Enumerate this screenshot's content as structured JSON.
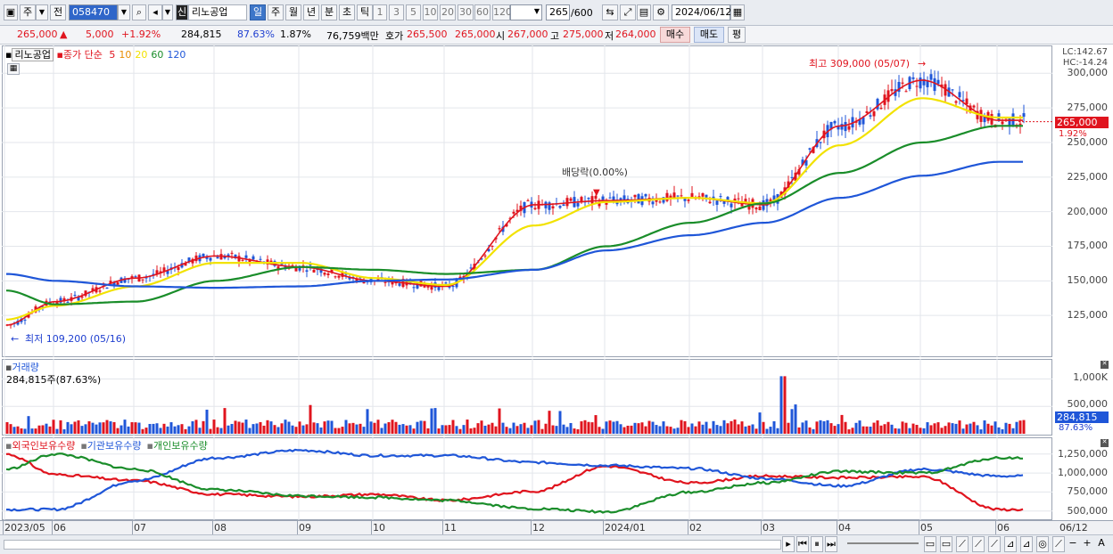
{
  "toolbar": {
    "type_label": "주",
    "prev_label": "전",
    "code": "058470",
    "name_badge": "신",
    "name": "리노공업",
    "periods": [
      "일",
      "주",
      "월",
      "년",
      "분",
      "초",
      "틱"
    ],
    "ticks": [
      "1",
      "3",
      "5",
      "10",
      "20",
      "30",
      "60",
      "120"
    ],
    "count": "265",
    "count_max": "/600",
    "date": "2024/06/12"
  },
  "quote": {
    "price": "265,000",
    "change": "5,000",
    "pct": "+1.92%",
    "volume": "284,815",
    "vol_ratio": "87.63%",
    "turnover": "1.87%",
    "amount": "76,759백만",
    "ask_label": "호가",
    "ask": "265,500",
    "bid": "265,000",
    "open_label": "시",
    "open": "267,000",
    "high_label": "고",
    "high": "275,000",
    "low_label": "저",
    "low": "264,000",
    "buy": "매수",
    "sell": "매도",
    "avg": "평"
  },
  "legend": {
    "name": "리노공업",
    "ma_label": "종가 단순",
    "ma": [
      "5",
      "10",
      "20",
      "60",
      "120"
    ],
    "ma_colors": [
      "#e0141e",
      "#e88d00",
      "#f2e200",
      "#1a8d2a",
      "#1f56d8"
    ]
  },
  "axis_top": {
    "lc": "LC:142.67",
    "hc": "HC:-14.24",
    "labels": [
      "300,000",
      "275,000",
      "250,000",
      "225,000",
      "200,000",
      "175,000",
      "150,000",
      "125,000"
    ],
    "price_tag": "265,000",
    "price_pct": "1.92%"
  },
  "annotations": {
    "high": "최고 309,000 (05/07)",
    "low": "최저 109,200 (05/16)",
    "dividend": "배당락(0.00%)"
  },
  "volume": {
    "title": "거래량",
    "value": "284,815주(87.63%)",
    "labels": [
      "1,000K",
      "500,000"
    ],
    "tag": "284,815",
    "tag_pct": "87.63%"
  },
  "investors": {
    "series": [
      "외국인보유수량",
      "기관보유수량",
      "개인보유수량"
    ],
    "colors": [
      "#e0141e",
      "#1f56d8",
      "#1a8d2a"
    ],
    "labels": [
      "1,250,000",
      "1,000,000",
      "750,000",
      "500,000"
    ]
  },
  "xaxis": {
    "labels": [
      "2023/05",
      "06",
      "07",
      "08",
      "09",
      "10",
      "11",
      "12",
      "2024/01",
      "02",
      "03",
      "04",
      "05",
      "06"
    ],
    "right": "06/12"
  },
  "chart_data": {
    "type": "line",
    "title": "리노공업",
    "ylim": [
      100000,
      315000
    ],
    "x": [
      "2023/05",
      "06",
      "07",
      "08",
      "09",
      "10",
      "11",
      "12",
      "2024/01",
      "02",
      "03",
      "04",
      "05",
      "06"
    ],
    "series": [
      {
        "name": "5",
        "values": [
          118000,
          135000,
          152000,
          168000,
          160000,
          150000,
          146000,
          205000,
          208000,
          210000,
          205000,
          262000,
          295000,
          266000
        ]
      },
      {
        "name": "20",
        "values": [
          122000,
          132000,
          146000,
          163000,
          163000,
          152000,
          147000,
          190000,
          207000,
          210000,
          206000,
          248000,
          282000,
          268000
        ]
      },
      {
        "name": "60",
        "values": [
          143000,
          133000,
          135000,
          150000,
          160000,
          158000,
          155000,
          158000,
          175000,
          192000,
          206000,
          228000,
          250000,
          262000
        ]
      },
      {
        "name": "120",
        "values": [
          155000,
          150000,
          146000,
          145000,
          146000,
          150000,
          151000,
          158000,
          172000,
          183000,
          192000,
          210000,
          226000,
          236000
        ]
      }
    ],
    "high": {
      "value": 309000,
      "date": "05/07"
    },
    "low": {
      "value": 109200,
      "date": "05/16"
    },
    "last": 265000,
    "volume": {
      "ylim": [
        0,
        1300000
      ],
      "last": 284815
    },
    "holdings": {
      "ylim": [
        450000,
        1400000
      ],
      "series": [
        {
          "name": "외국인보유수량",
          "values": [
            1250000,
            980000,
            900000,
            720000,
            690000,
            720000,
            640000,
            760000,
            1090000,
            870000,
            960000,
            940000,
            950000,
            520000
          ]
        },
        {
          "name": "기관보유수량",
          "values": [
            520000,
            520000,
            900000,
            1200000,
            1300000,
            1230000,
            1230000,
            1140000,
            1100000,
            1060000,
            930000,
            830000,
            1050000,
            960000
          ]
        },
        {
          "name": "개인보유수량",
          "values": [
            1050000,
            1250000,
            1050000,
            780000,
            700000,
            680000,
            640000,
            530000,
            490000,
            750000,
            870000,
            1020000,
            1000000,
            1200000
          ]
        }
      ]
    }
  }
}
